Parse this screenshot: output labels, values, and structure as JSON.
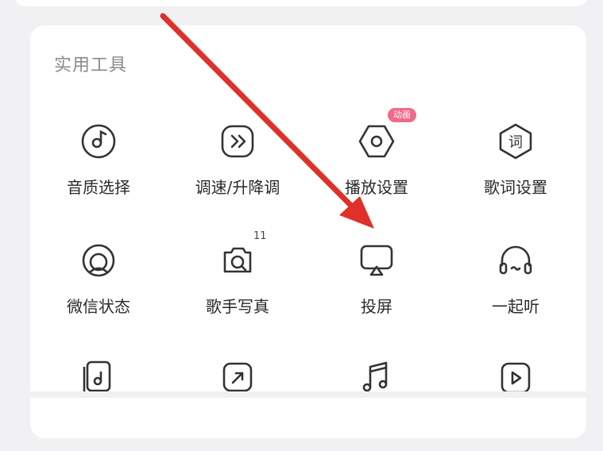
{
  "section": {
    "title": "实用工具"
  },
  "tools": [
    {
      "label": "音质选择",
      "icon": "music-disc-icon"
    },
    {
      "label": "调速/升降调",
      "icon": "fast-forward-icon"
    },
    {
      "label": "播放设置",
      "icon": "settings-hexagon-icon",
      "badge": "动画"
    },
    {
      "label": "歌词设置",
      "icon": "lyrics-icon",
      "glyph": "词"
    },
    {
      "label": "微信状态",
      "icon": "wechat-status-icon"
    },
    {
      "label": "歌手写真",
      "icon": "camera-photo-icon",
      "count": "11"
    },
    {
      "label": "投屏",
      "icon": "screen-cast-icon"
    },
    {
      "label": "一起听",
      "icon": "headphones-icon"
    }
  ],
  "colors": {
    "accent": "#f06a8a",
    "arrow": "#e0302a",
    "icon": "#333333",
    "title": "#8a8a8a"
  }
}
